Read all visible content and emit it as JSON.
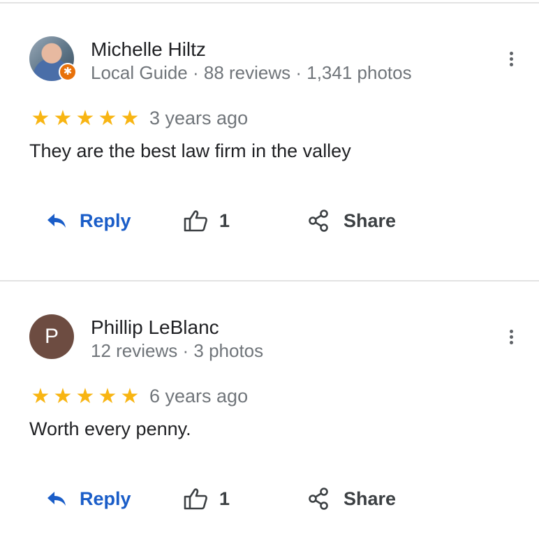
{
  "reviews": [
    {
      "author": "Michelle Hiltz",
      "meta": "Local Guide · 88 reviews · 1,341 photos",
      "avatar_type": "photo",
      "local_guide_badge": true,
      "rating": 5,
      "time": "3 years ago",
      "text": "They are the best law firm in the valley",
      "reply_label": "Reply",
      "like_count": "1",
      "share_label": "Share"
    },
    {
      "author": "Phillip LeBlanc",
      "meta": "12 reviews · 3 photos",
      "avatar_type": "letter",
      "avatar_letter": "P",
      "avatar_color": "#6d4c41",
      "local_guide_badge": false,
      "rating": 5,
      "time": "6 years ago",
      "text": "Worth every penny.",
      "reply_label": "Reply",
      "like_count": "1",
      "share_label": "Share"
    }
  ],
  "icons": {
    "reply": "reply-arrow-icon",
    "like": "thumbs-up-icon",
    "share": "share-icon",
    "more": "more-vert-icon",
    "star": "star-icon"
  },
  "colors": {
    "star": "#f8b513",
    "reply": "#1a5dc8",
    "secondary_text": "#70757a",
    "divider": "#e3e3e3"
  }
}
